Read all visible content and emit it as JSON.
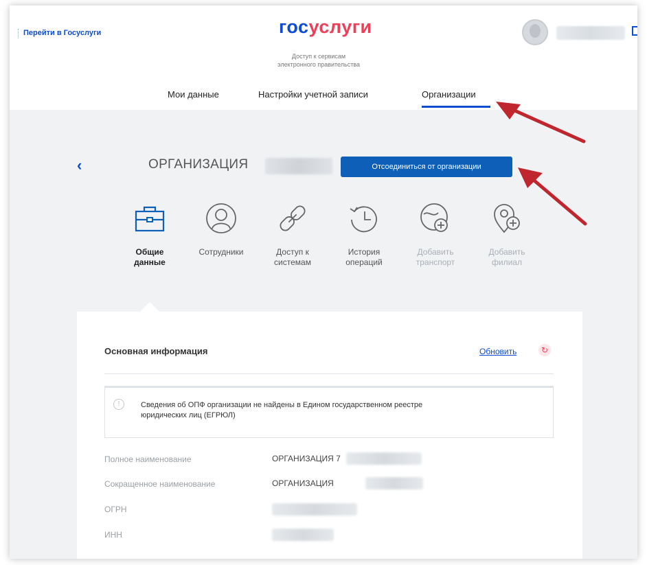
{
  "header": {
    "goto_link": "Перейти в Госуслуги",
    "logo_part1": "гос",
    "logo_part2": "услуги",
    "tagline_line1": "Доступ к сервисам",
    "tagline_line2": "электронного правительства"
  },
  "tabs": [
    {
      "label": "Мои данные"
    },
    {
      "label": "Настройки учетной записи"
    },
    {
      "label": "Организации"
    }
  ],
  "org": {
    "back_icon": "‹",
    "title": "ОРГАНИЗАЦИЯ",
    "disconnect_label": "Отсоединиться от организации"
  },
  "section_nav": [
    {
      "label_line1": "Общие",
      "label_line2": "данные",
      "icon": "briefcase-icon",
      "active": true
    },
    {
      "label_line1": "Сотрудники",
      "label_line2": "",
      "icon": "user-icon"
    },
    {
      "label_line1": "Доступ к",
      "label_line2": "системам",
      "icon": "link-icon"
    },
    {
      "label_line1": "История",
      "label_line2": "операций",
      "icon": "history-icon"
    },
    {
      "label_line1": "Добавить",
      "label_line2": "транспорт",
      "icon": "add-transport-icon",
      "disabled": true
    },
    {
      "label_line1": "Добавить",
      "label_line2": "филиал",
      "icon": "add-branch-icon",
      "disabled": true
    }
  ],
  "card": {
    "title": "Основная информация",
    "refresh_label": "Обновить",
    "notice_icon": "!",
    "notice_line1": "Сведения об ОПФ организации не найдены в Едином государственном реестре",
    "notice_line2": "юридических лиц (ЕГРЮЛ)",
    "fields": [
      {
        "label": "Полное наименование",
        "value": "ОРГАНИЗАЦИЯ 7"
      },
      {
        "label": "Сокращенное наименование",
        "value": "ОРГАНИЗАЦИЯ"
      },
      {
        "label": "ОГРН",
        "value": ""
      },
      {
        "label": "ИНН",
        "value": ""
      }
    ],
    "refresh_icon_glyph": "↻"
  },
  "colors": {
    "accent_blue": "#0d4cd3",
    "brand_red": "#ee3f58",
    "button_blue": "#0d5fb8",
    "annotation_arrow": "#c0262d",
    "background_gray": "#f0f2f4"
  }
}
